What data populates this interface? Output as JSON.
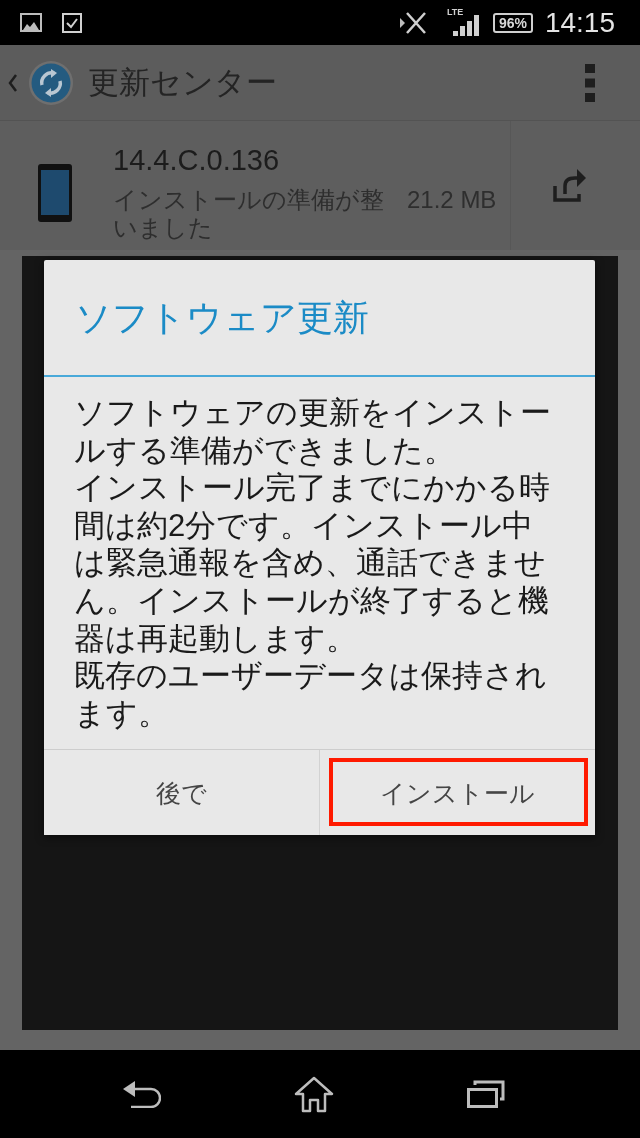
{
  "status_bar": {
    "network_type": "LTE",
    "battery": "96%",
    "time": "14:15"
  },
  "app_bar": {
    "title": "更新センター"
  },
  "update_item": {
    "version": "14.4.C.0.136",
    "status": "インストールの準備が整いました",
    "size": "21.2 MB"
  },
  "dialog": {
    "title": "ソフトウェア更新",
    "paragraphs": [
      "ソフトウェアの更新をインストールする準備ができました。",
      "インストール完了までにかかる時間は約2分です。インストール中は緊急通報を含め、通話できません。インストールが終了すると機器は再起動します。",
      "既存のユーザーデータは保持されます。"
    ],
    "buttons": [
      {
        "label": "後で",
        "highlighted": false
      },
      {
        "label": "インストール",
        "highlighted": true
      }
    ]
  }
}
